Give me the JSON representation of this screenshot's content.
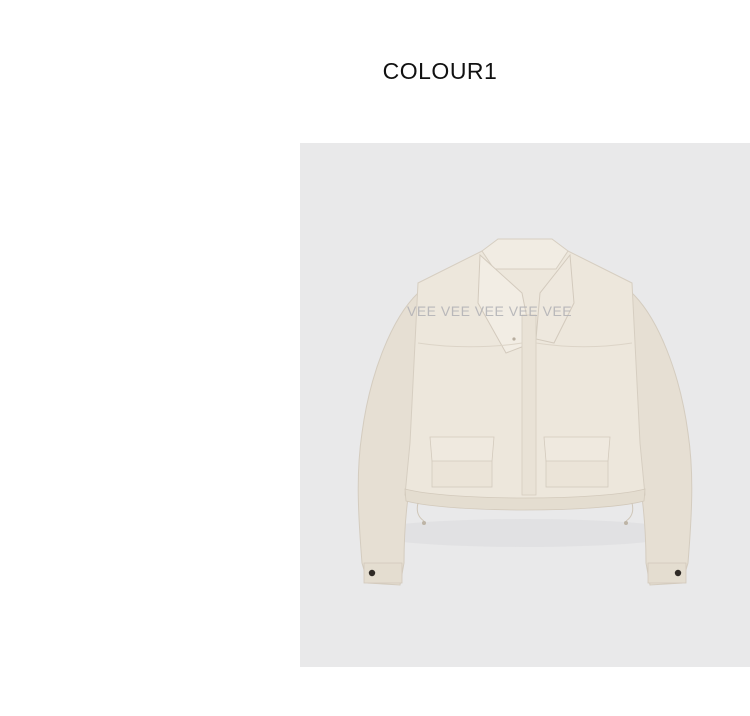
{
  "heading": "COLOUR1",
  "product_image": {
    "subject": "cropped-jacket",
    "garment_color": "#ede7dc",
    "background_color": "#e9e9ea",
    "watermark": "VEE VEE VEE VEE VEE"
  }
}
